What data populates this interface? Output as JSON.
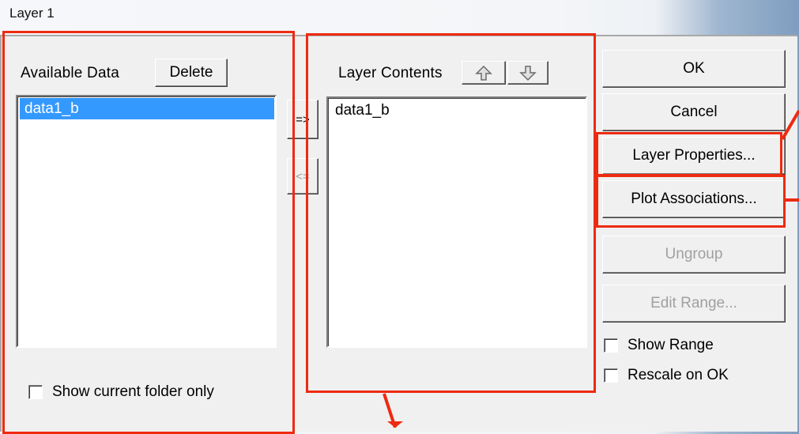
{
  "window": {
    "title": "Layer 1"
  },
  "available": {
    "label": "Available Data",
    "delete_label": "Delete",
    "items": [
      "data1_b"
    ],
    "selected_index": 0,
    "show_current_folder_label": "Show current folder only",
    "show_current_folder_checked": false
  },
  "transfer": {
    "add_label": "=>",
    "remove_label": "<="
  },
  "layer": {
    "label": "Layer Contents",
    "move_up_icon": "arrow-up-icon",
    "move_down_icon": "arrow-down-icon",
    "items": [
      "data1_b"
    ]
  },
  "buttons": {
    "ok": "OK",
    "cancel": "Cancel",
    "layer_properties": "Layer Properties...",
    "plot_associations": "Plot Associations...",
    "ungroup": "Ungroup",
    "edit_range": "Edit Range..."
  },
  "options": {
    "show_range_label": "Show Range",
    "show_range_checked": false,
    "rescale_label": "Rescale on OK",
    "rescale_checked": false
  },
  "annotation_color": "#ee2a10"
}
